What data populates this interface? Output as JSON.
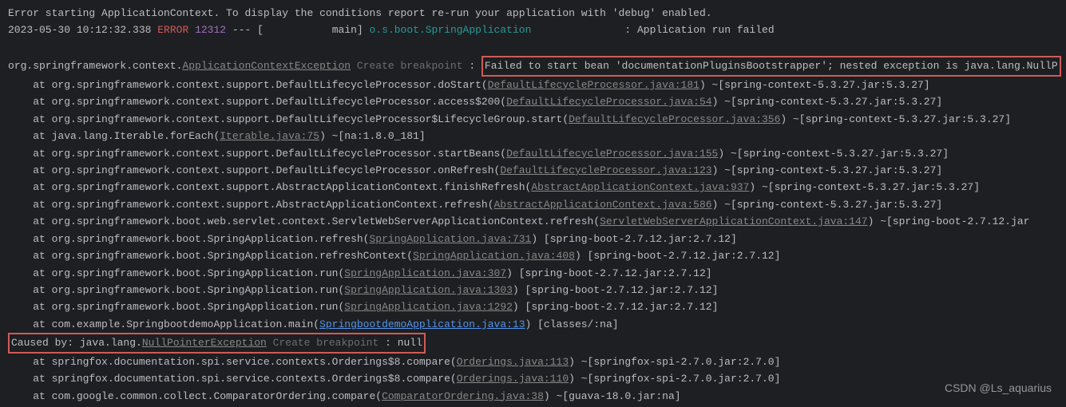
{
  "header_line": "Error starting ApplicationContext. To display the conditions report re-run your application with 'debug' enabled.",
  "log": {
    "timestamp": "2023-05-30 10:12:32.338",
    "level": "ERROR",
    "pid": "12312",
    "sep": " --- [           main] ",
    "logger": "o.s.boot.SpringApplication",
    "pad": "               ",
    "message": ": Application run failed"
  },
  "exc": {
    "prefix": "org.springframework.context.",
    "class": "ApplicationContextException",
    "bp": " Create breakpoint ",
    "colon": ": ",
    "msg": "Failed to start bean 'documentationPluginsBootstrapper'; nested exception is java.lang.NullP"
  },
  "traces": [
    {
      "pre": "    at org.springframework.context.support.DefaultLifecycleProcessor.doStart(",
      "link": "DefaultLifecycleProcessor.java:181",
      "post": ") ~[spring-context-5.3.27.jar:5.3.27]",
      "blue": false
    },
    {
      "pre": "    at org.springframework.context.support.DefaultLifecycleProcessor.access$200(",
      "link": "DefaultLifecycleProcessor.java:54",
      "post": ") ~[spring-context-5.3.27.jar:5.3.27]",
      "blue": false
    },
    {
      "pre": "    at org.springframework.context.support.DefaultLifecycleProcessor$LifecycleGroup.start(",
      "link": "DefaultLifecycleProcessor.java:356",
      "post": ") ~[spring-context-5.3.27.jar:5.3.27]",
      "blue": false
    },
    {
      "pre": "    at java.lang.Iterable.forEach(",
      "link": "Iterable.java:75",
      "post": ") ~[na:1.8.0_181]",
      "blue": false
    },
    {
      "pre": "    at org.springframework.context.support.DefaultLifecycleProcessor.startBeans(",
      "link": "DefaultLifecycleProcessor.java:155",
      "post": ") ~[spring-context-5.3.27.jar:5.3.27]",
      "blue": false
    },
    {
      "pre": "    at org.springframework.context.support.DefaultLifecycleProcessor.onRefresh(",
      "link": "DefaultLifecycleProcessor.java:123",
      "post": ") ~[spring-context-5.3.27.jar:5.3.27]",
      "blue": false
    },
    {
      "pre": "    at org.springframework.context.support.AbstractApplicationContext.finishRefresh(",
      "link": "AbstractApplicationContext.java:937",
      "post": ") ~[spring-context-5.3.27.jar:5.3.27]",
      "blue": false
    },
    {
      "pre": "    at org.springframework.context.support.AbstractApplicationContext.refresh(",
      "link": "AbstractApplicationContext.java:586",
      "post": ") ~[spring-context-5.3.27.jar:5.3.27]",
      "blue": false
    },
    {
      "pre": "    at org.springframework.boot.web.servlet.context.ServletWebServerApplicationContext.refresh(",
      "link": "ServletWebServerApplicationContext.java:147",
      "post": ") ~[spring-boot-2.7.12.jar",
      "blue": false
    },
    {
      "pre": "    at org.springframework.boot.SpringApplication.refresh(",
      "link": "SpringApplication.java:731",
      "post": ") [spring-boot-2.7.12.jar:2.7.12]",
      "blue": false
    },
    {
      "pre": "    at org.springframework.boot.SpringApplication.refreshContext(",
      "link": "SpringApplication.java:408",
      "post": ") [spring-boot-2.7.12.jar:2.7.12]",
      "blue": false
    },
    {
      "pre": "    at org.springframework.boot.SpringApplication.run(",
      "link": "SpringApplication.java:307",
      "post": ") [spring-boot-2.7.12.jar:2.7.12]",
      "blue": false
    },
    {
      "pre": "    at org.springframework.boot.SpringApplication.run(",
      "link": "SpringApplication.java:1303",
      "post": ") [spring-boot-2.7.12.jar:2.7.12]",
      "blue": false
    },
    {
      "pre": "    at org.springframework.boot.SpringApplication.run(",
      "link": "SpringApplication.java:1292",
      "post": ") [spring-boot-2.7.12.jar:2.7.12]",
      "blue": false
    },
    {
      "pre": "    at com.example.SpringbootdemoApplication.main(",
      "link": "SpringbootdemoApplication.java:13",
      "post": ") [classes/:na]",
      "blue": true
    }
  ],
  "cause": {
    "prefix": "Caused by: java.lang.",
    "class": "NullPointerException",
    "bp": " Create breakpoint ",
    "msg": ": null"
  },
  "cause_traces": [
    {
      "pre": "    at springfox.documentation.spi.service.contexts.Orderings$8.compare(",
      "link": "Orderings.java:113",
      "post": ") ~[springfox-spi-2.7.0.jar:2.7.0]",
      "blue": false
    },
    {
      "pre": "    at springfox.documentation.spi.service.contexts.Orderings$8.compare(",
      "link": "Orderings.java:110",
      "post": ") ~[springfox-spi-2.7.0.jar:2.7.0]",
      "blue": false
    },
    {
      "pre": "    at com.google.common.collect.ComparatorOrdering.compare(",
      "link": "ComparatorOrdering.java:38",
      "post": ") ~[guava-18.0.jar:na]",
      "blue": false
    }
  ],
  "watermark": "CSDN @Ls_aquarius"
}
